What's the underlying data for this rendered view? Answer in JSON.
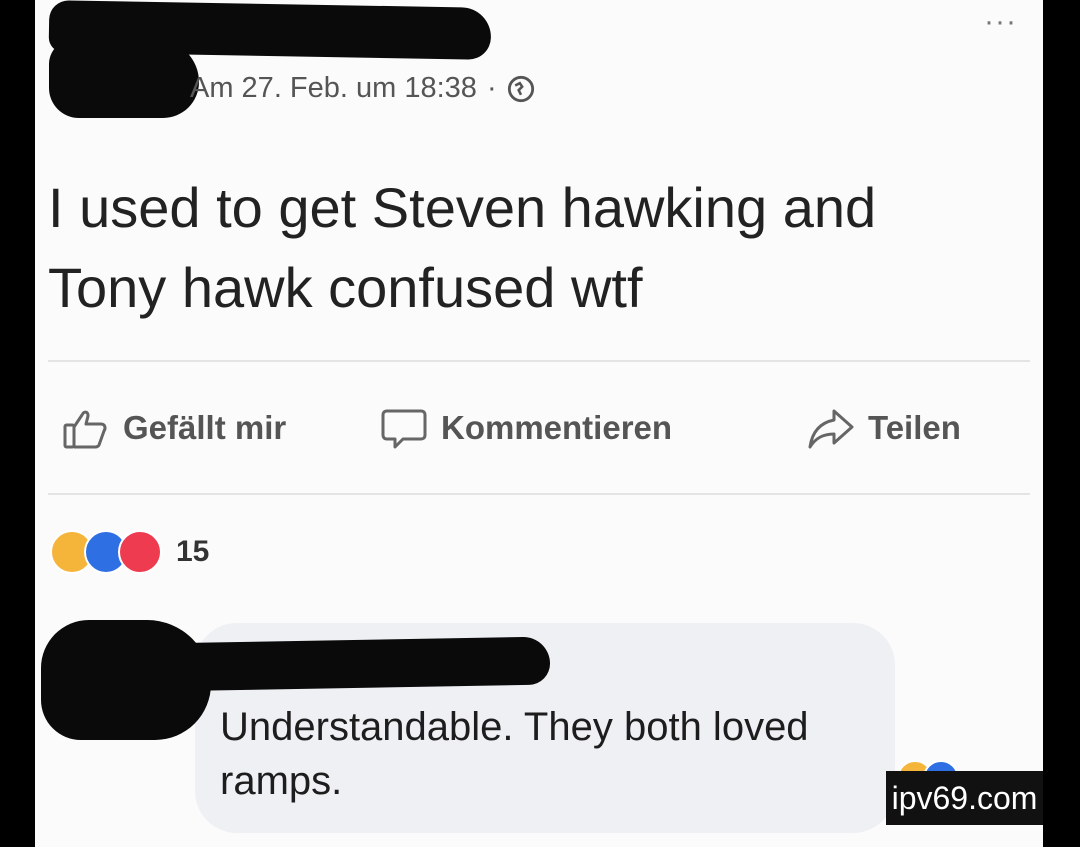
{
  "post": {
    "timestamp": "Am 27. Feb. um 18:38",
    "separator": "·",
    "more_label": "···",
    "text": "I used to get Steven hawking and Tony hawk confused wtf"
  },
  "actions": {
    "like_label": "Gefällt mir",
    "comment_label": "Kommentieren",
    "share_label": "Teilen"
  },
  "reactions": {
    "icons": [
      "haha-icon",
      "like-icon",
      "love-icon"
    ],
    "count": "15"
  },
  "comment": {
    "text": "Understandable. They both loved ramps."
  },
  "watermark": "ipv69.com",
  "colors": {
    "like": "#2e6fe3",
    "love": "#ee3b50",
    "haha": "#f5b53a"
  }
}
